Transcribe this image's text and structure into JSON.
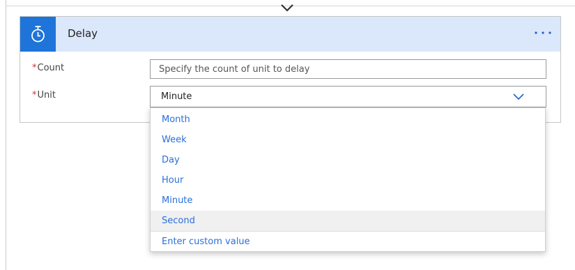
{
  "card": {
    "title": "Delay",
    "icon": "stopwatch-icon",
    "more_icon": "more-options-icon"
  },
  "fields": {
    "count": {
      "label": "Count",
      "required_mark": "*",
      "value": "",
      "placeholder": "Specify the count of unit to delay"
    },
    "unit": {
      "label": "Unit",
      "required_mark": "*",
      "value": "Minute"
    }
  },
  "dropdown": {
    "options": [
      "Month",
      "Week",
      "Day",
      "Hour",
      "Minute",
      "Second"
    ],
    "highlighted": "Second",
    "custom_option": "Enter custom value"
  },
  "colors": {
    "accent": "#1e74d9",
    "header_bg": "#dbe7fb",
    "link": "#2a6fd9",
    "required": "#d0313e"
  }
}
